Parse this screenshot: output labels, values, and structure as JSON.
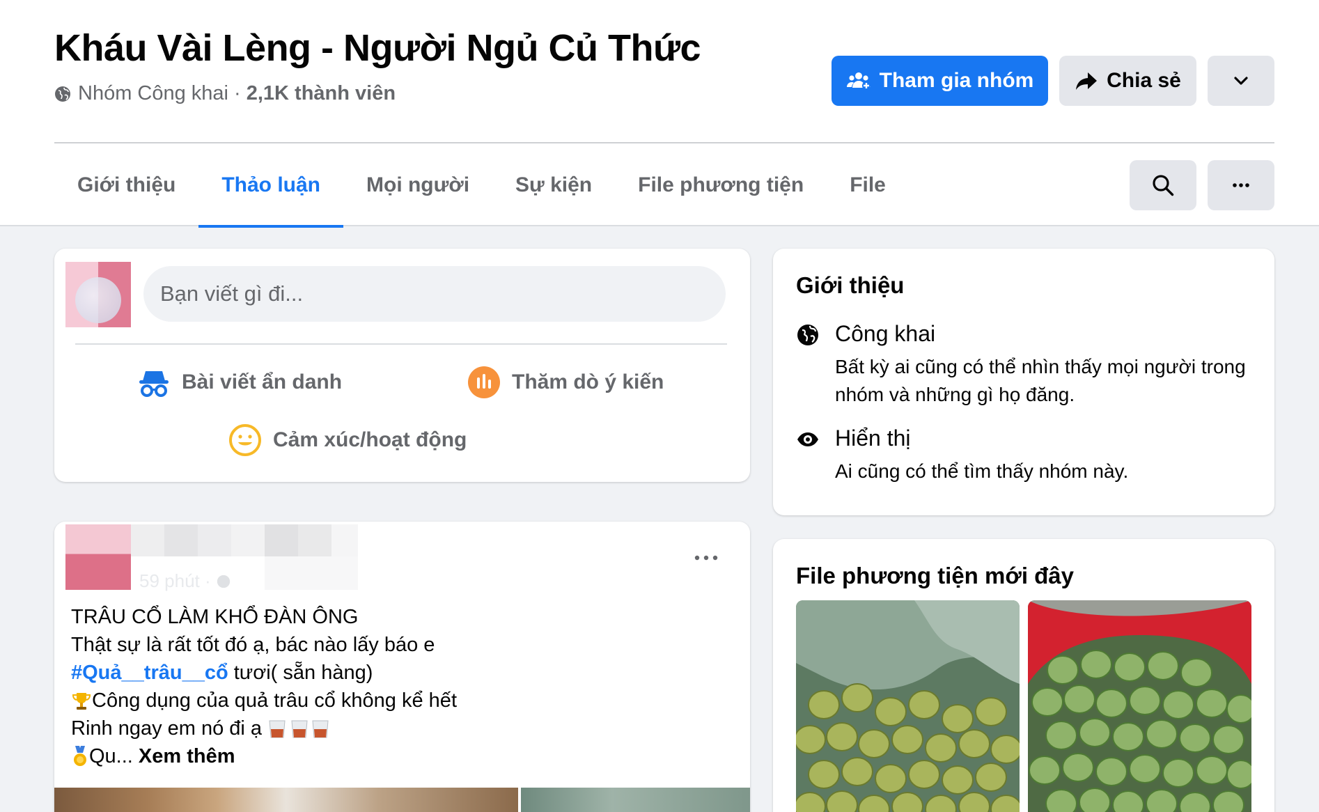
{
  "group": {
    "title": "Kháu Vài Lèng - Người Ngủ Củ Thức",
    "privacy": "Nhóm Công khai ·",
    "members": "2,1K thành viên"
  },
  "header_actions": {
    "join": "Tham gia nhóm",
    "share": "Chia sẻ"
  },
  "tabs": [
    {
      "label": "Giới thiệu"
    },
    {
      "label": "Thảo luận",
      "active": true
    },
    {
      "label": "Mọi người"
    },
    {
      "label": "Sự kiện"
    },
    {
      "label": "File phương tiện"
    },
    {
      "label": "File"
    }
  ],
  "composer": {
    "placeholder": "Bạn viết gì đi...",
    "actions": {
      "anonymous": "Bài viết ẩn danh",
      "poll": "Thăm dò ý kiến",
      "feeling": "Cảm xúc/hoạt động"
    }
  },
  "post": {
    "time": "59 phút ·",
    "lines": {
      "l1": "TRÂU CỔ LÀM KHỔ ĐÀN ÔNG",
      "l2": "Thật sự là rất tốt đó ạ, bác nào lấy báo e",
      "hashtag": "#Quả__trâu__cổ",
      "l3_rest": " tươi( sẵn hàng)",
      "l4": "Công dụng của quả trâu cổ không kể hết",
      "l5": "Rinh ngay em nó đi ạ ",
      "l6": "Qu...",
      "see_more": "Xem thêm"
    }
  },
  "about": {
    "title": "Giới thiệu",
    "public": {
      "heading": "Công khai",
      "desc": "Bất kỳ ai cũng có thể nhìn thấy mọi người trong nhóm và những gì họ đăng."
    },
    "visible": {
      "heading": "Hiển thị",
      "desc": "Ai cũng có thể tìm thấy nhóm này."
    }
  },
  "media": {
    "title": "File phương tiện mới đây"
  },
  "colors": {
    "primary": "#1877f2",
    "secondary_button": "#e4e6eb",
    "background": "#f0f2f5",
    "muted_text": "#65676b"
  }
}
